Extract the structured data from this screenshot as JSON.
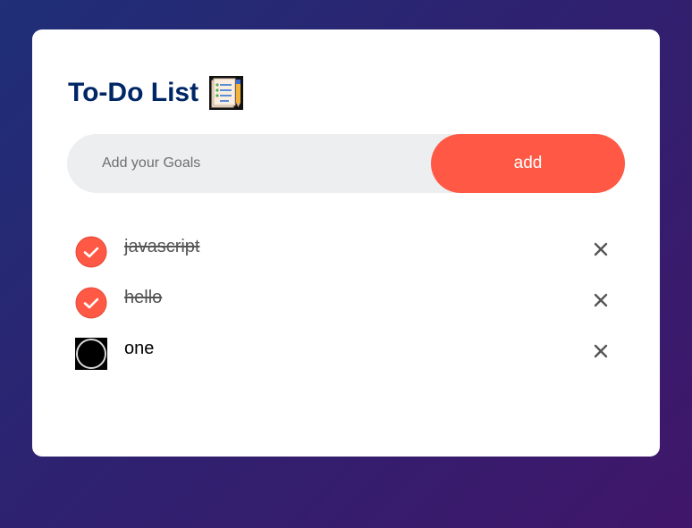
{
  "app": {
    "title": "To-Do List",
    "title_icon": "notepad-checklist-icon"
  },
  "input": {
    "placeholder": "Add your Goals",
    "value": ""
  },
  "add_button": {
    "label": "add"
  },
  "colors": {
    "accent": "#ff5945",
    "title": "#002765",
    "input_bg": "#edeef0"
  },
  "tasks": [
    {
      "text": "javascript",
      "checked": true
    },
    {
      "text": "hello",
      "checked": true
    },
    {
      "text": "one",
      "checked": false
    }
  ],
  "remove_icon": "close-icon"
}
